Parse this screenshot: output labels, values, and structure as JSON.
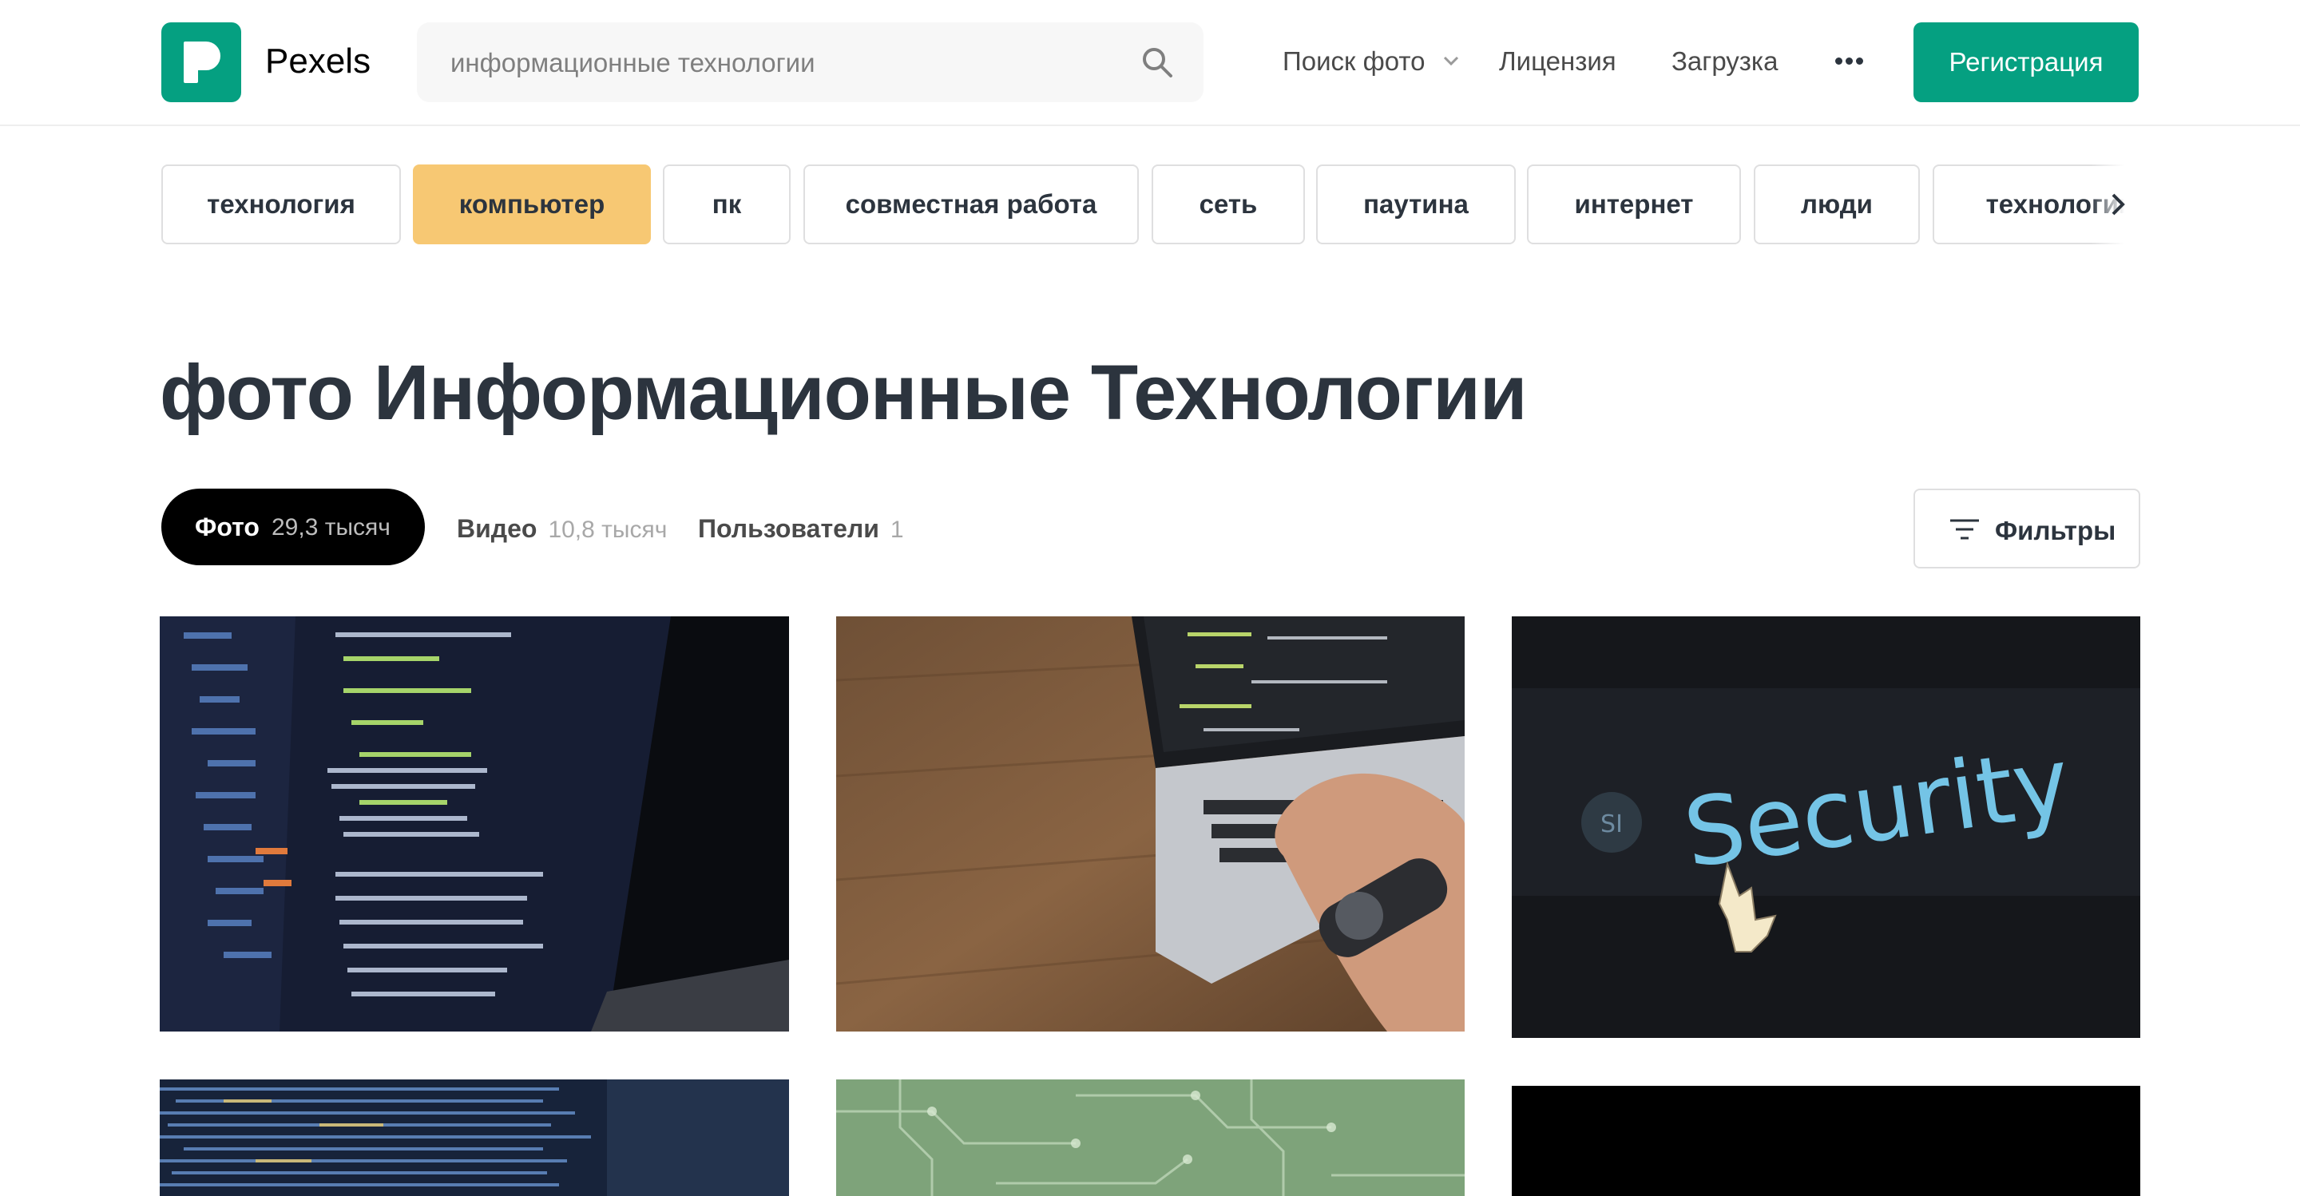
{
  "brand": {
    "name": "Pexels",
    "color": "#05a081"
  },
  "search": {
    "value": "информационные технологии"
  },
  "nav": {
    "photo_search": "Поиск фото",
    "license": "Лицензия",
    "upload": "Загрузка",
    "join": "Регистрация"
  },
  "tags": [
    {
      "label": "технология",
      "active": false
    },
    {
      "label": "компьютер",
      "active": true
    },
    {
      "label": "пк",
      "active": false
    },
    {
      "label": "совместная работа",
      "active": false
    },
    {
      "label": "сеть",
      "active": false
    },
    {
      "label": "паутина",
      "active": false
    },
    {
      "label": "интернет",
      "active": false
    },
    {
      "label": "люди",
      "active": false
    },
    {
      "label": "технологии",
      "active": false
    }
  ],
  "colors": {
    "active_tag": "#f7c873",
    "accent": "#05a081",
    "text": "#2c343e"
  },
  "title": "фото Информационные Технологии",
  "tabs": {
    "photos": {
      "label": "Фото",
      "count": "29,3 тысяч"
    },
    "videos": {
      "label": "Видео",
      "count": "10,8 тысяч"
    },
    "users": {
      "label": "Пользователи",
      "count": "1"
    }
  },
  "filters": {
    "label": "Фильтры"
  },
  "photos": {
    "security_text": "Security"
  }
}
